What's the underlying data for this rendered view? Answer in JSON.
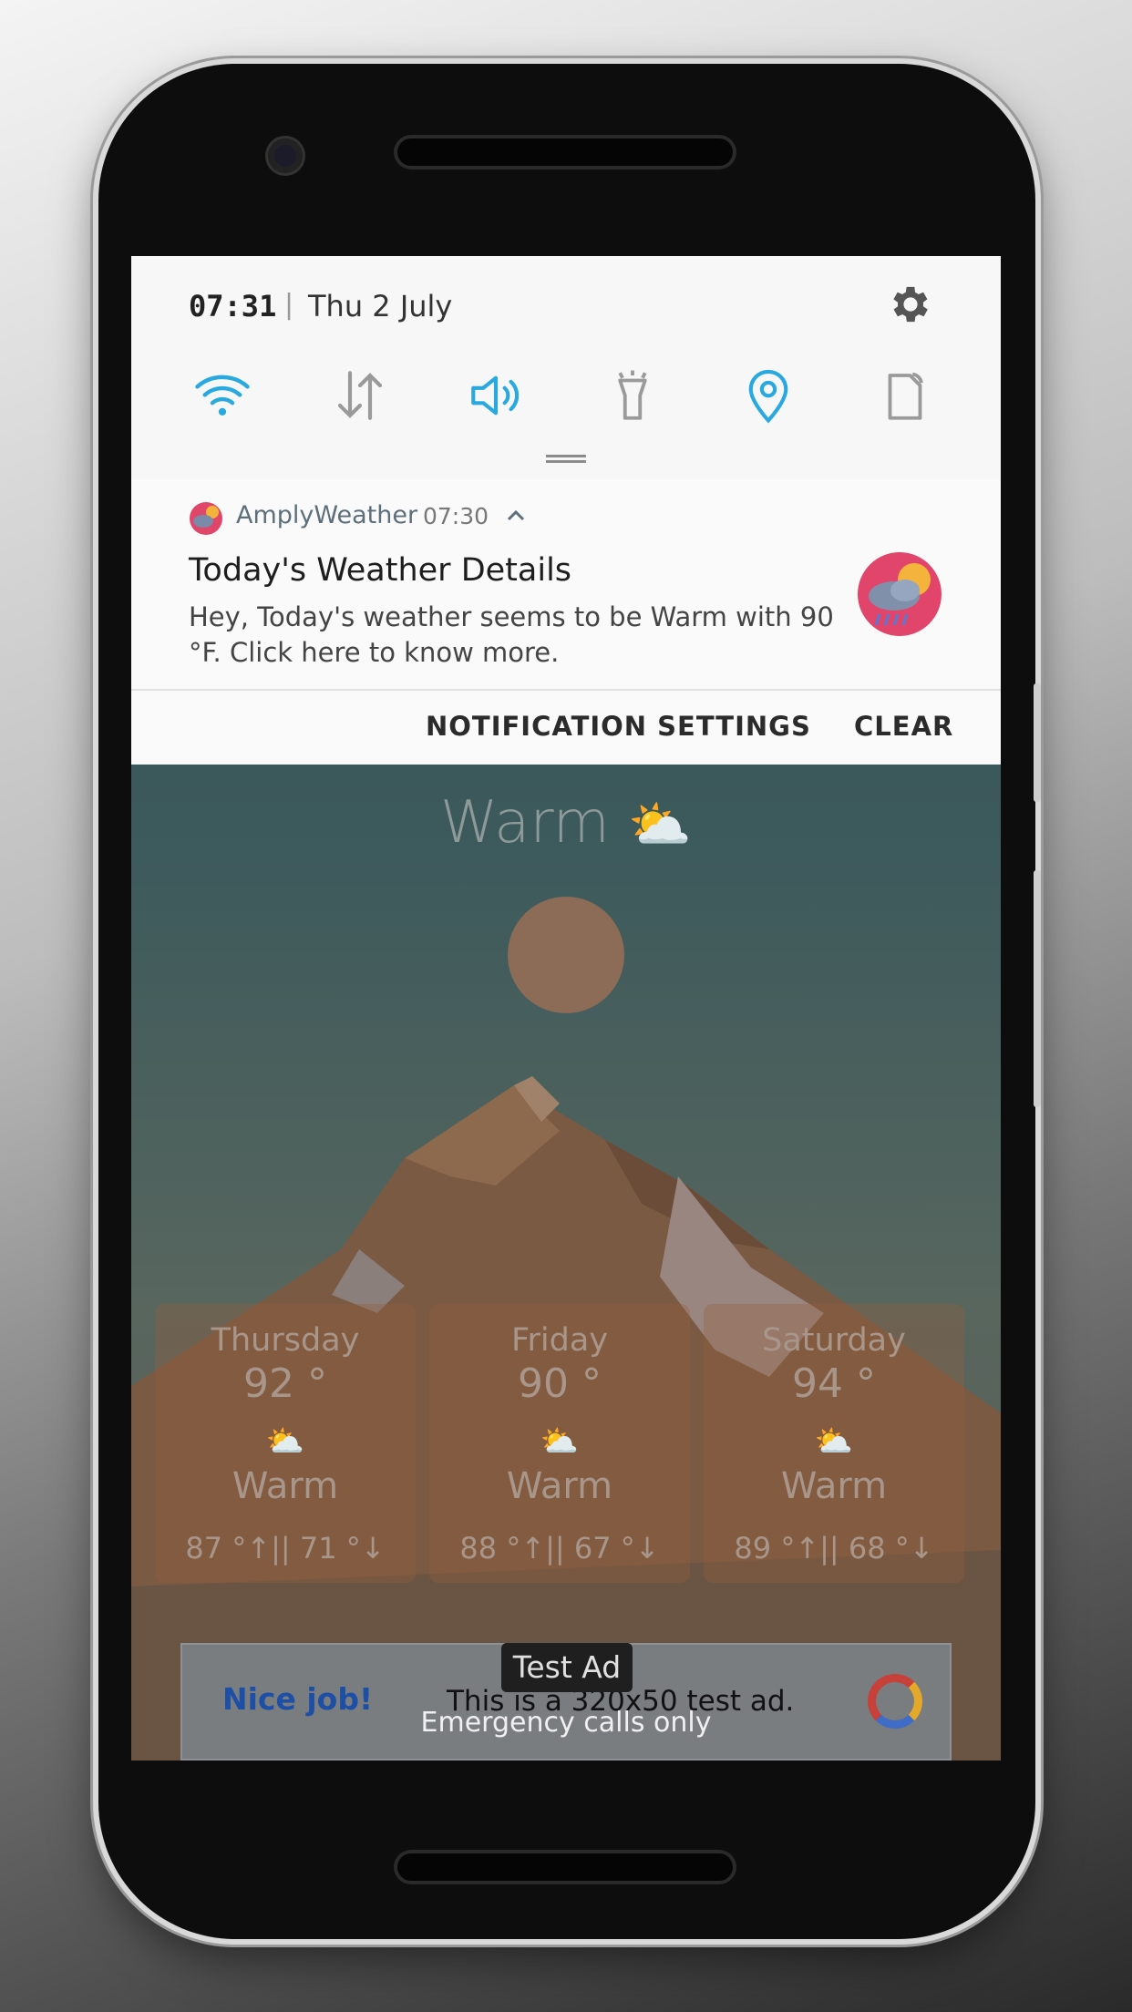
{
  "status": {
    "time": "07:31",
    "separator": "|",
    "date": "Thu 2 July"
  },
  "quick_settings": [
    {
      "name": "wifi",
      "icon": "wifi-icon",
      "active": true
    },
    {
      "name": "mobile-data",
      "icon": "data-arrows-icon",
      "active": false
    },
    {
      "name": "sound",
      "icon": "speaker-icon",
      "active": true
    },
    {
      "name": "flashlight",
      "icon": "flashlight-icon",
      "active": false
    },
    {
      "name": "location",
      "icon": "location-pin-icon",
      "active": true
    },
    {
      "name": "auto-rotate",
      "icon": "rotate-icon",
      "active": false
    }
  ],
  "notification": {
    "app_name": "AmplyWeather",
    "time": "07:30",
    "title": "Today's Weather Details",
    "body": "Hey, Today's weather seems to be Warm with 90 °F. Click here to know more."
  },
  "actions": {
    "settings_label": "NOTIFICATION SETTINGS",
    "clear_label": "CLEAR"
  },
  "app": {
    "current_condition": "Warm",
    "forecast": [
      {
        "day": "Thursday",
        "temp": "92 °",
        "condition": "Warm",
        "range": "87 °↑|| 71 °↓"
      },
      {
        "day": "Friday",
        "temp": "90 °",
        "condition": "Warm",
        "range": "88 °↑|| 67 °↓"
      },
      {
        "day": "Saturday",
        "temp": "94 °",
        "condition": "Warm",
        "range": "89 °↑|| 68 °↓"
      }
    ]
  },
  "ad": {
    "badge": "Test Ad",
    "headline": "Nice job!",
    "text": "This is a 320x50 test ad."
  },
  "footer": {
    "emergency": "Emergency calls only"
  },
  "colors": {
    "accent_active": "#29a9e0",
    "inactive_icon": "#9a9a9a"
  }
}
